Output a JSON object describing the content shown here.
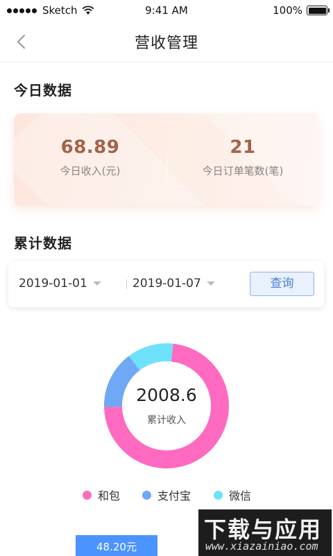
{
  "status_bar": {
    "carrier": "Sketch",
    "time": "9:41 AM",
    "battery_text": "100%",
    "battery_level": 1.0
  },
  "nav": {
    "title": "营收管理",
    "back_icon": "chevron-left-icon"
  },
  "today": {
    "section_title": "今日数据",
    "income_value": "68.89",
    "income_label": "今日收入(元)",
    "orders_value": "21",
    "orders_label": "今日订单笔数(笔)"
  },
  "cumulative": {
    "section_title": "累计数据",
    "start_date": "2019-01-01",
    "end_date": "2019-01-07",
    "query_label": "查询"
  },
  "chart_data": {
    "type": "pie",
    "center_value": "2008.6",
    "center_label": "累计收入",
    "categories": [
      "和包",
      "支付宝",
      "微信"
    ],
    "values": [
      73,
      15,
      12
    ],
    "colors": [
      "#ff6ac1",
      "#6fa8f5",
      "#6fe2fb"
    ]
  },
  "amount_bar": {
    "text": "48.20元"
  },
  "watermark": {
    "main": "下载与应用",
    "sub": "www.xiazainiao.com"
  },
  "colors": {
    "accent_blue": "#4b93ff",
    "card_value": "#a4634a"
  }
}
